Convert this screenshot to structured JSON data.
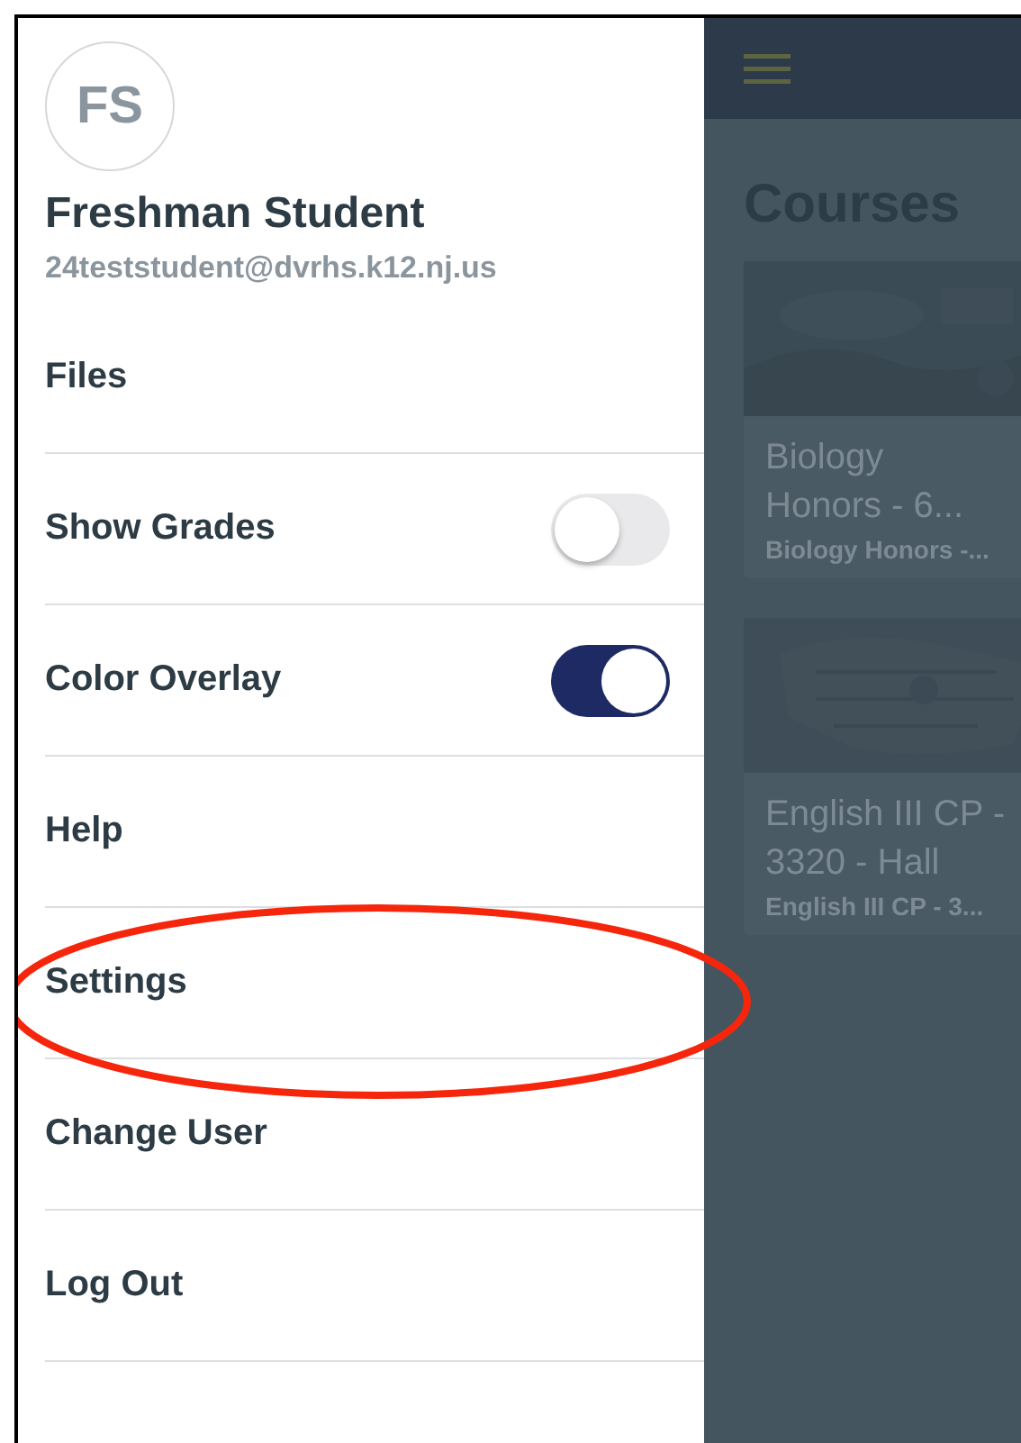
{
  "drawer": {
    "profile": {
      "initials": "FS",
      "name": "Freshman Student",
      "email": "24teststudent@dvrhs.k12.nj.us"
    },
    "items": [
      {
        "label": "Files",
        "kind": "link"
      },
      {
        "label": "Show Grades",
        "kind": "toggle",
        "on": false
      },
      {
        "label": "Color Overlay",
        "kind": "toggle",
        "on": true
      },
      {
        "label": "Help",
        "kind": "link"
      },
      {
        "label": "Settings",
        "kind": "link"
      },
      {
        "label": "Change User",
        "kind": "link"
      },
      {
        "label": "Log Out",
        "kind": "link"
      }
    ]
  },
  "main": {
    "title": "Courses",
    "courses": [
      {
        "title": "Biology Honors - 6...",
        "subtitle": "Biology Honors -..."
      },
      {
        "title": "English III CP - 3320 - Hall",
        "subtitle": "English III CP - 3..."
      }
    ]
  }
}
